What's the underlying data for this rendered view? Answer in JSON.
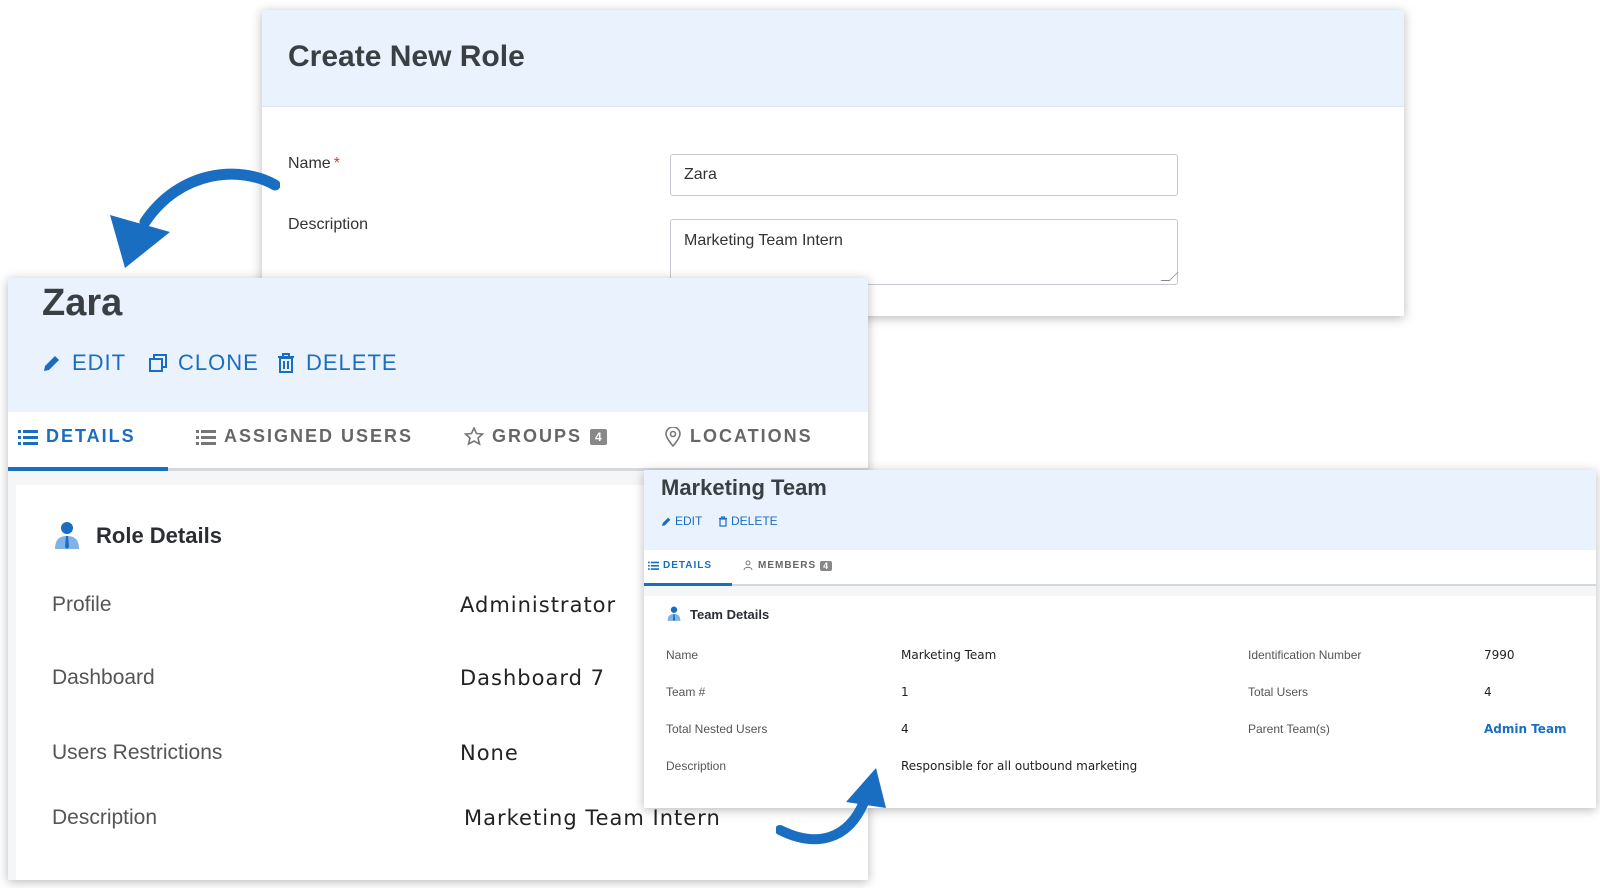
{
  "create_role": {
    "title": "Create New Role",
    "name_label": "Name",
    "required_mark": "*",
    "name_value": "Zara",
    "description_label": "Description",
    "description_value": "Marketing Team Intern"
  },
  "role": {
    "title": "Zara",
    "actions": {
      "edit": "EDIT",
      "clone": "CLONE",
      "delete": "DELETE"
    },
    "tabs": [
      {
        "label": "DETAILS",
        "icon": "list-icon"
      },
      {
        "label": "ASSIGNED USERS",
        "icon": "list-icon"
      },
      {
        "label": "GROUPS",
        "icon": "badge-star-icon",
        "count": "4"
      },
      {
        "label": "LOCATIONS",
        "icon": "map-pin-icon"
      }
    ],
    "section_title": "Role Details",
    "fields": [
      {
        "label": "Profile",
        "value": "Administrator"
      },
      {
        "label": "Dashboard",
        "value": "Dashboard 7"
      },
      {
        "label": "Users Restrictions",
        "value": "None"
      },
      {
        "label": "Description",
        "value": "Marketing Team Intern"
      }
    ]
  },
  "team": {
    "title": "Marketing Team",
    "actions": {
      "edit": "EDIT",
      "delete": "DELETE"
    },
    "tabs": [
      {
        "label": "DETAILS",
        "icon": "list-icon"
      },
      {
        "label": "MEMBERS",
        "icon": "users-icon",
        "count": "4"
      }
    ],
    "section_title": "Team Details",
    "fields": {
      "name": {
        "label": "Name",
        "value": "Marketing Team"
      },
      "team_no": {
        "label": "Team #",
        "value": "1"
      },
      "nested_users": {
        "label": "Total Nested Users",
        "value": "4"
      },
      "description": {
        "label": "Description",
        "value": "Responsible for all outbound marketing"
      },
      "id_number": {
        "label": "Identification Number",
        "value": "7990"
      },
      "total_users": {
        "label": "Total Users",
        "value": "4"
      },
      "parent_team": {
        "label": "Parent Team(s)",
        "value": "Admin Team"
      }
    }
  },
  "colors": {
    "accent": "#1a6ec1",
    "header_bg": "#eaf3fd",
    "required": "#e53935"
  }
}
